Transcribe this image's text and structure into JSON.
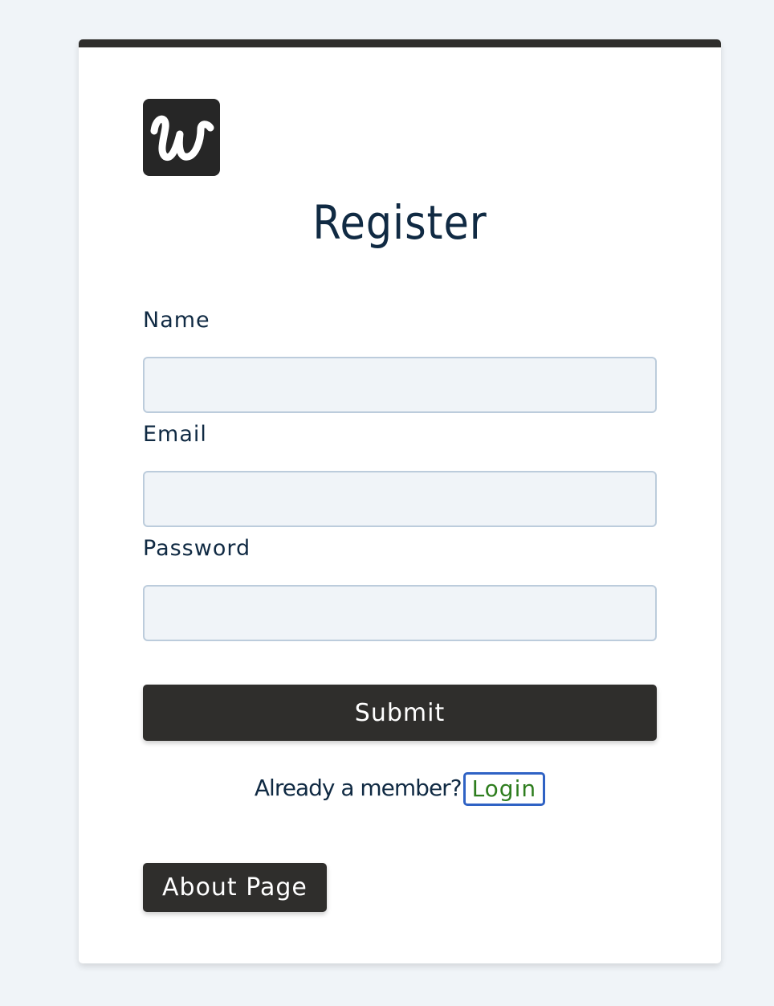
{
  "logo": {
    "icon": "w-logo-icon",
    "glyph": "w",
    "background": "#262626"
  },
  "page": {
    "title": "Register"
  },
  "form": {
    "name_label": "Name",
    "name_value": "",
    "email_label": "Email",
    "email_value": "",
    "password_label": "Password",
    "password_value": "",
    "submit_label": "Submit"
  },
  "member": {
    "prompt": "Already a member?",
    "login_label": "Login"
  },
  "footer": {
    "about_label": "About Page"
  },
  "colors": {
    "page_background": "#f0f4f8",
    "card_background": "#ffffff",
    "dark": "#2f2e2c",
    "text": "#102a43",
    "input_background": "#f0f4f8",
    "input_border": "#bcccdc",
    "link": "#2e7d1e",
    "focus_outline": "#2f62c4"
  }
}
